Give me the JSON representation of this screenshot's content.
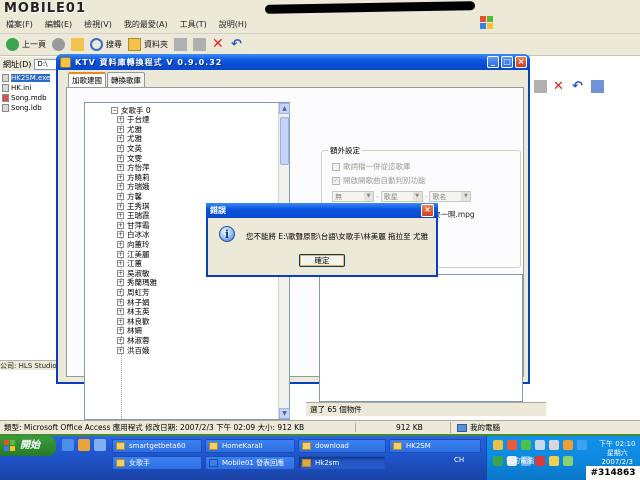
{
  "brand": "MOBILE01",
  "explorer": {
    "menu": [
      "檔案(F)",
      "編輯(E)",
      "檢視(V)",
      "我的最愛(A)",
      "工具(T)",
      "說明(H)"
    ],
    "toolbar": {
      "back": "上一頁",
      "search": "搜尋",
      "folders": "資料夾"
    },
    "address_label": "網址(D)",
    "address_value": "D:\\",
    "files": [
      "HK2SM.exe",
      "HK.ini",
      "Song.mdb",
      "Song.ldb"
    ],
    "left_status": "公司: HLS Studio",
    "statusbar": {
      "info": "類型: Microsoft Office Access 應用程式 修改日期: 2007/2/3 下午 02:09 大小: 912 KB",
      "size": "912 KB",
      "location": "我的電腦"
    },
    "second_status": "選了 65 個物件"
  },
  "ktv": {
    "title": "KTV 資料庫轉換程式 V 0.9.0.32",
    "tabs": [
      "加歌建國",
      "轉換歌庫"
    ],
    "tree_root": "女歌手 0",
    "tree_items": [
      "于台煙",
      "尤雅",
      "尤雅",
      "文英",
      "文雯",
      "方怡萍",
      "方曉莉",
      "方瑞娥",
      "方馨",
      "王秀琪",
      "王瑞霞",
      "甘萍霜",
      "白冰冰",
      "向蕙玲",
      "江美麗",
      "江蕙",
      "吳淑敏",
      "秀蘭瑪雅",
      "周虹芳",
      "林子娟",
      "林玉英",
      "林良歡",
      "林姍",
      "林淑蓉",
      "洪百娥"
    ],
    "settings": {
      "legend": "額外設定",
      "check1": "歌詞檔一併從這歌庫",
      "check2": "開啟開歌曲自動判別功能",
      "combo1": "無",
      "combo2": "歌星",
      "combo3": "歌名",
      "example": "範例: 江蕙&伍思凱-秋雨彼一暝.mpg"
    }
  },
  "dialog": {
    "title": "錯誤",
    "message": "您不能將 E:\\歌聲原影\\台語\\女歌手\\林美麗 拖拉至 尤雅",
    "ok": "確定"
  },
  "taskbar": {
    "start": "開始",
    "tasks": [
      "smartgetbeta60",
      "HomeKaraII",
      "download",
      "HK2SM",
      "女歌手",
      "Mobile01 發表回應",
      "Hk2sm"
    ],
    "ch": "CH",
    "mypc": "我的電腦",
    "time": "下午 02:10",
    "weekday": "星期六",
    "date": "2007/2/3"
  },
  "watermark": "#314863",
  "colors": {
    "xp_blue": "#0a55e0",
    "tab_accent": "#e68b2c",
    "start_green": "#2f8a2f"
  }
}
